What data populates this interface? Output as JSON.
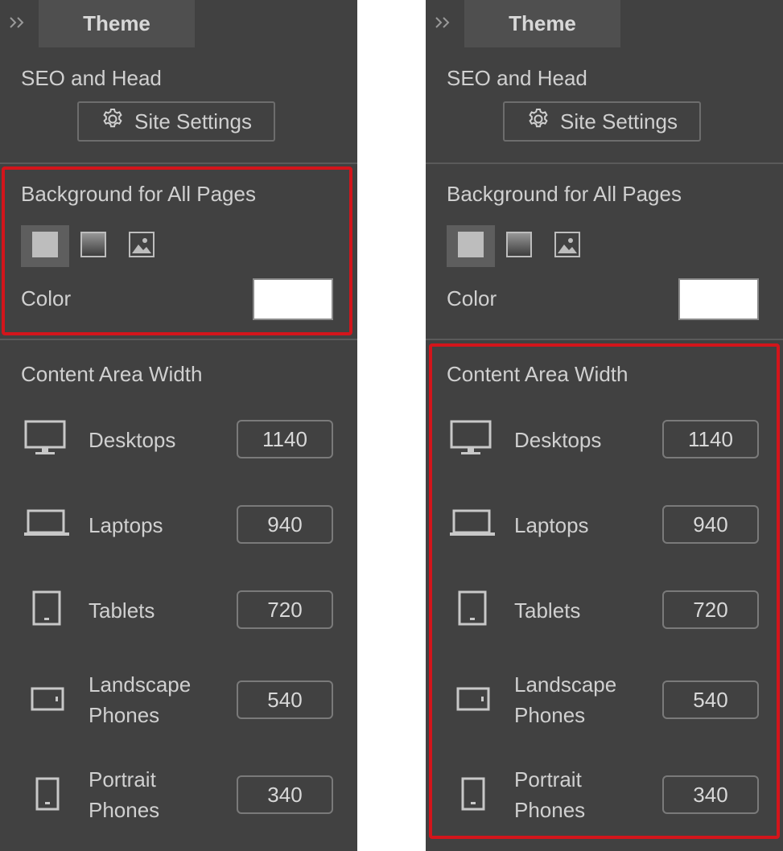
{
  "colors": {
    "panel_bg": "#414141",
    "highlight": "#d3151b",
    "swatch": "#ffffff"
  },
  "panels": [
    {
      "highlighted_section": "background",
      "tab_label": "Theme",
      "seo_title": "SEO and Head",
      "site_settings_label": "Site Settings",
      "background_title": "Background for All Pages",
      "background_types": [
        "solid-icon",
        "gradient-icon",
        "image-icon"
      ],
      "color_label": "Color",
      "content_width_title": "Content Area Width",
      "devices": [
        {
          "icon": "desktop-icon",
          "label": "Desktops",
          "value": "1140"
        },
        {
          "icon": "laptop-icon",
          "label": "Laptops",
          "value": "940"
        },
        {
          "icon": "tablet-icon",
          "label": "Tablets",
          "value": "720"
        },
        {
          "icon": "landscape-phone-icon",
          "label": "Landscape Phones",
          "value": "540"
        },
        {
          "icon": "portrait-phone-icon",
          "label": "Portrait Phones",
          "value": "340"
        }
      ]
    },
    {
      "highlighted_section": "content-area-width",
      "tab_label": "Theme",
      "seo_title": "SEO and Head",
      "site_settings_label": "Site Settings",
      "background_title": "Background for All Pages",
      "background_types": [
        "solid-icon",
        "gradient-icon",
        "image-icon"
      ],
      "color_label": "Color",
      "content_width_title": "Content Area Width",
      "devices": [
        {
          "icon": "desktop-icon",
          "label": "Desktops",
          "value": "1140"
        },
        {
          "icon": "laptop-icon",
          "label": "Laptops",
          "value": "940"
        },
        {
          "icon": "tablet-icon",
          "label": "Tablets",
          "value": "720"
        },
        {
          "icon": "landscape-phone-icon",
          "label": "Landscape Phones",
          "value": "540"
        },
        {
          "icon": "portrait-phone-icon",
          "label": "Portrait Phones",
          "value": "340"
        }
      ]
    }
  ]
}
